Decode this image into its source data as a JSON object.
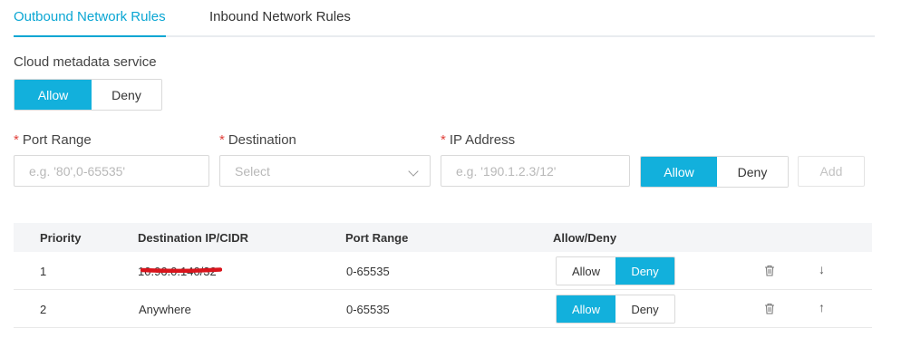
{
  "tabs": [
    {
      "label": "Outbound Network Rules",
      "active": true
    },
    {
      "label": "Inbound Network Rules",
      "active": false
    }
  ],
  "metadata": {
    "label": "Cloud metadata service",
    "options": [
      "Allow",
      "Deny"
    ],
    "selected": "Allow"
  },
  "form": {
    "port_range": {
      "label": "Port Range",
      "required_mark": "*",
      "placeholder": "e.g. '80',0-65535'"
    },
    "destination": {
      "label": "Destination",
      "required_mark": "*",
      "placeholder": "Select"
    },
    "ip_address": {
      "label": "IP Address",
      "required_mark": "*",
      "placeholder": "e.g. '190.1.2.3/12'"
    },
    "action_options": [
      "Allow",
      "Deny"
    ],
    "action_selected": "Allow",
    "add_label": "Add"
  },
  "table": {
    "columns": [
      "Priority",
      "Destination IP/CIDR",
      "Port Range",
      "Allow/Deny"
    ],
    "rows": [
      {
        "priority": "1",
        "destination": "10.96.0.140/32",
        "port_range": "0-65535",
        "action": "Deny",
        "redacted": true,
        "arrow": "↓"
      },
      {
        "priority": "2",
        "destination": "Anywhere",
        "port_range": "0-65535",
        "action": "Allow",
        "redacted": false,
        "arrow": "↑"
      }
    ],
    "allow_label": "Allow",
    "deny_label": "Deny"
  },
  "colors": {
    "accent": "#12b0dc",
    "tab_active": "#0aa6d3",
    "required": "#e0403a",
    "redaction": "#d9141c"
  },
  "icons": {
    "row_delete": "trash-icon",
    "row_move_down": "arrow-down-icon",
    "row_move_up": "arrow-up-icon",
    "select_chevron": "chevron-down-icon"
  }
}
